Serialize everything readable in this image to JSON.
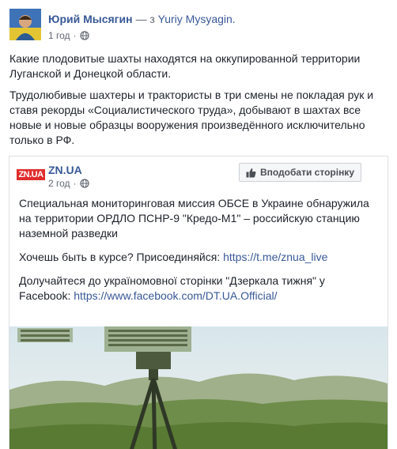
{
  "post": {
    "author": "Юрий Мысягин",
    "via_separator": "— з",
    "via_name": "Yuriy Mysyagin.",
    "time": "1 год",
    "meta_dot": "·",
    "paragraphs": [
      "Какие плодовитые шахты находятся на оккупированной территории Луганской и Донецкой области.",
      "Трудолюбивые шахтеры и трактористы в три смены не покладая рук и ставя рекорды «Социалистического труда», добывают в шахтах все новые и новые образцы вооружения произведённого исключительно только в РФ."
    ]
  },
  "shared": {
    "logo_text": "ZN.UA",
    "page_name": "ZN.UA",
    "time": "2 год",
    "meta_dot": "·",
    "follow_label": "Вподобати сторінку",
    "text_main": "Специальная мониторинговая миссия ОБСЕ в Украине обнаружила на территории ОРДЛО ПСНР-9 \"Кредо-М1\" – российскую станцию наземной разведки",
    "join_text": "Хочешь быть в курсе? Присоединяйся: ",
    "join_link": "https://t.me/znua_live",
    "ua_text": "Долучайтеся до україномовної сторінки \"Дзеркала тижня\" у Facebook: ",
    "ua_link": "https://www.facebook.com/DT.UA.Official/"
  },
  "icons": {
    "globe": "globe-icon",
    "thumb": "thumbs-up-icon"
  },
  "colors": {
    "link": "#385898",
    "text": "#1d2129",
    "meta": "#616770",
    "logo_red": "#e12c2c"
  }
}
